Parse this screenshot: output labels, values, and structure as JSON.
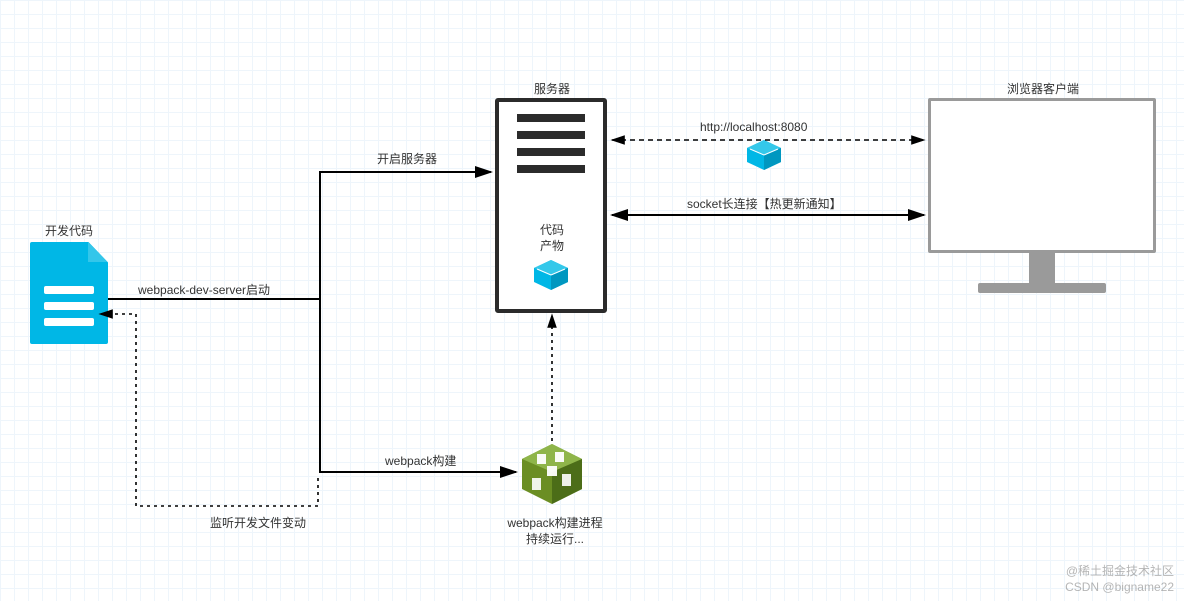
{
  "nodes": {
    "dev_code_title": "开发代码",
    "server_title": "服务器",
    "code_artifact_label": "代码\n产物",
    "browser_title": "浏览器客户端",
    "webpack_process_label": "webpack构建进程\n持续运行..."
  },
  "edges": {
    "start_server": "开启服务器",
    "dev_server_start": "webpack-dev-server启动",
    "webpack_build": "webpack构建",
    "watch_files": "监听开发文件变动",
    "http_url": "http://localhost:8080",
    "socket_link": "socket长连接【热更新通知】"
  },
  "watermark": {
    "line1": "@稀土掘金技术社区",
    "line2": "CSDN @bigname22"
  },
  "colors": {
    "accent": "#00b7e6",
    "green": "#6b8e23",
    "dark": "#2b2b2b",
    "gray": "#9a9a9a"
  }
}
